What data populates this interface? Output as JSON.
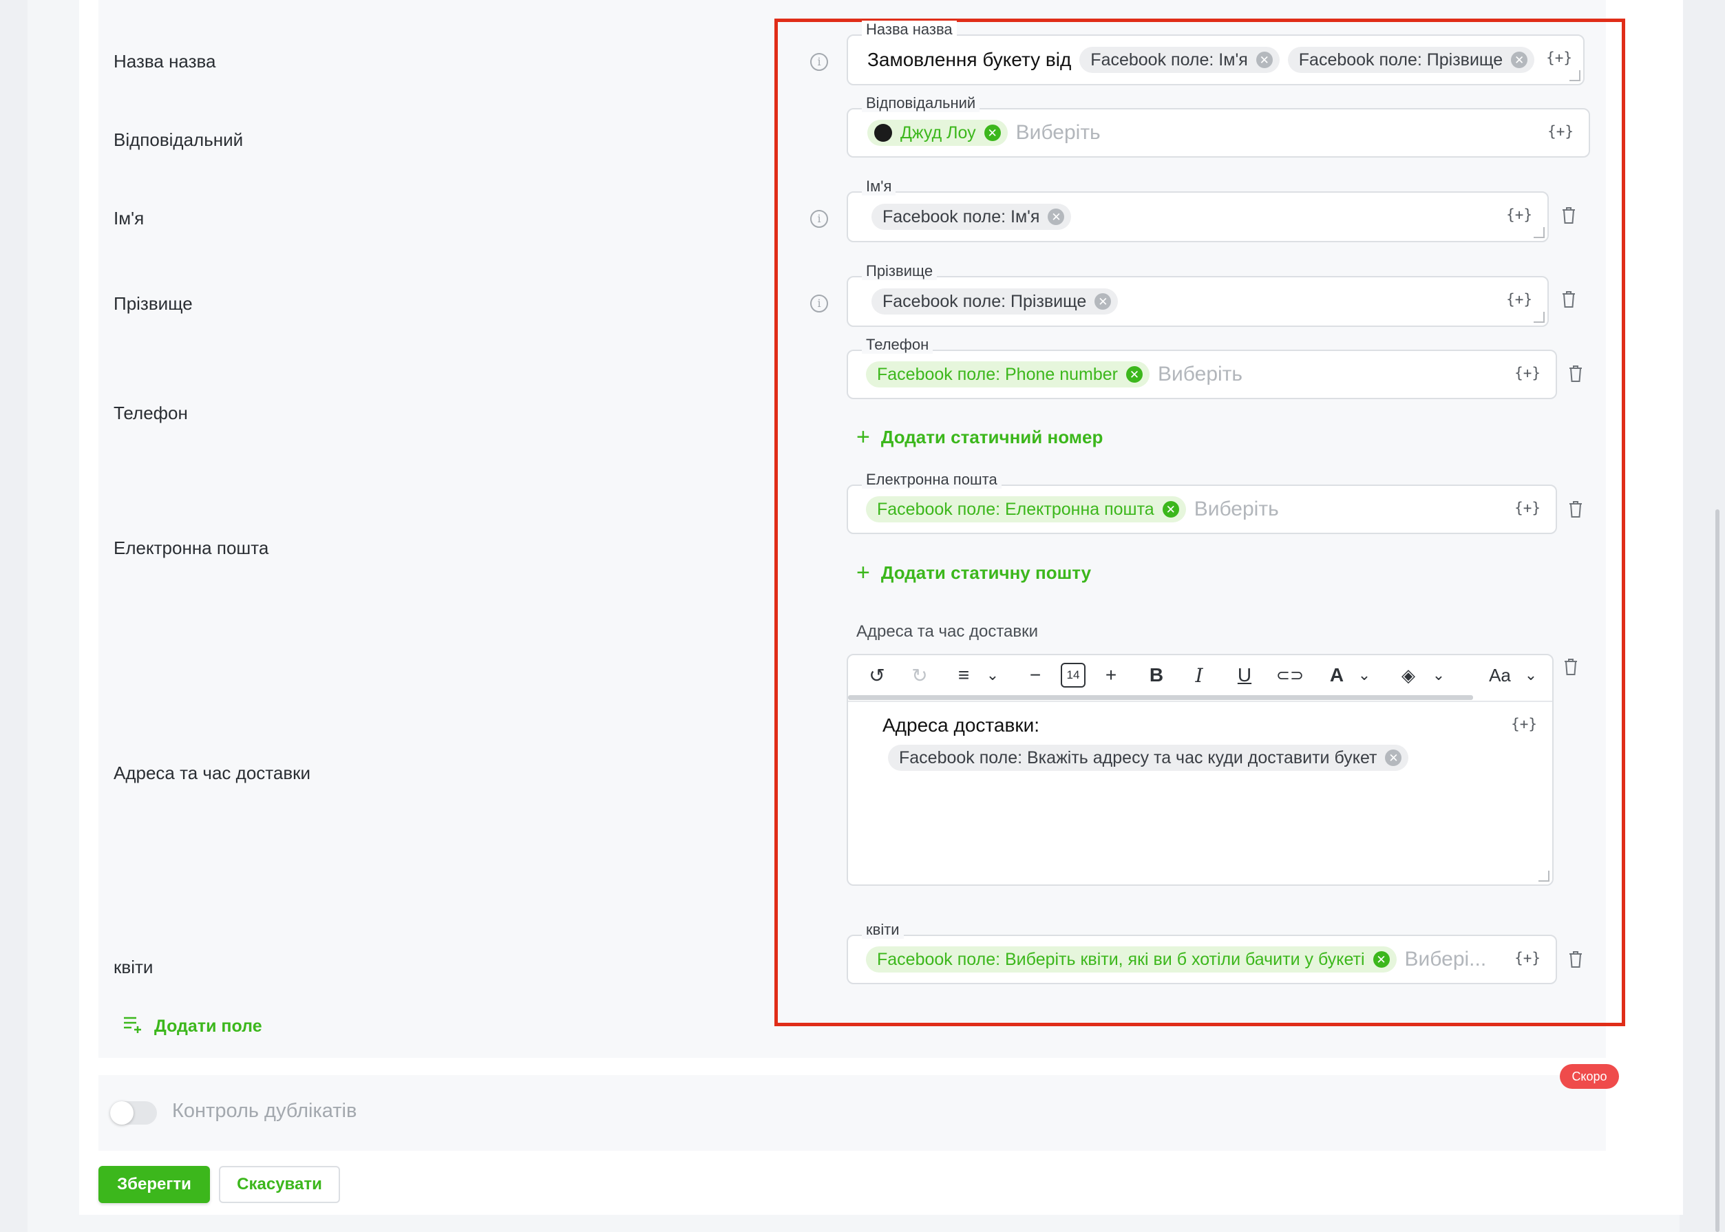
{
  "rows": {
    "title": "Назва назва",
    "responsible": "Відповідальний",
    "first_name": "Ім'я",
    "last_name": "Прізвище",
    "phone": "Телефон",
    "email": "Електронна пошта",
    "address": "Адреса та час доставки",
    "flowers": "квіти"
  },
  "fields": {
    "title": {
      "label": "Назва назва",
      "text": "Замовлення букету від",
      "chips": [
        "Facebook поле: Ім'я",
        "Facebook поле: Прізвище"
      ]
    },
    "responsible": {
      "label": "Відповідальний",
      "chip": "Джуд Лоу",
      "placeholder": "Виберіть"
    },
    "first_name": {
      "label": "Ім'я",
      "chip": "Facebook поле: Ім'я"
    },
    "last_name": {
      "label": "Прізвище",
      "chip": "Facebook поле: Прізвище"
    },
    "phone": {
      "label": "Телефон",
      "chip": "Facebook поле: Phone number",
      "placeholder": "Виберіть",
      "add_link": "Додати статичний номер"
    },
    "email": {
      "label": "Електронна пошта",
      "chip": "Facebook поле: Електронна пошта",
      "placeholder": "Виберіть",
      "add_link": "Додати статичну пошту"
    },
    "address": {
      "label": "Адреса та час доставки",
      "font_size": "14",
      "font_menu": "Aa",
      "body_title": "Адреса доставки:",
      "chip": "Facebook поле: Вкажіть адресу та час куди доставити букет"
    },
    "flowers": {
      "label": "квіти",
      "chip": "Facebook поле: Виберіть квіти, які ви б хотіли бачити у букеті",
      "placeholder": "Вибері..."
    }
  },
  "variable_icon_text": "{+}",
  "add_field": "Додати поле",
  "duplicates": {
    "label": "Контроль дублікатів",
    "badge": "Скоро",
    "enabled": false
  },
  "buttons": {
    "save": "Зберегти",
    "cancel": "Скасувати"
  },
  "colors": {
    "accent_green": "#3cb71c",
    "chip_green_bg": "#e6f6dc",
    "highlight_red": "#e02d18",
    "badge_red": "#ef4b4b"
  }
}
